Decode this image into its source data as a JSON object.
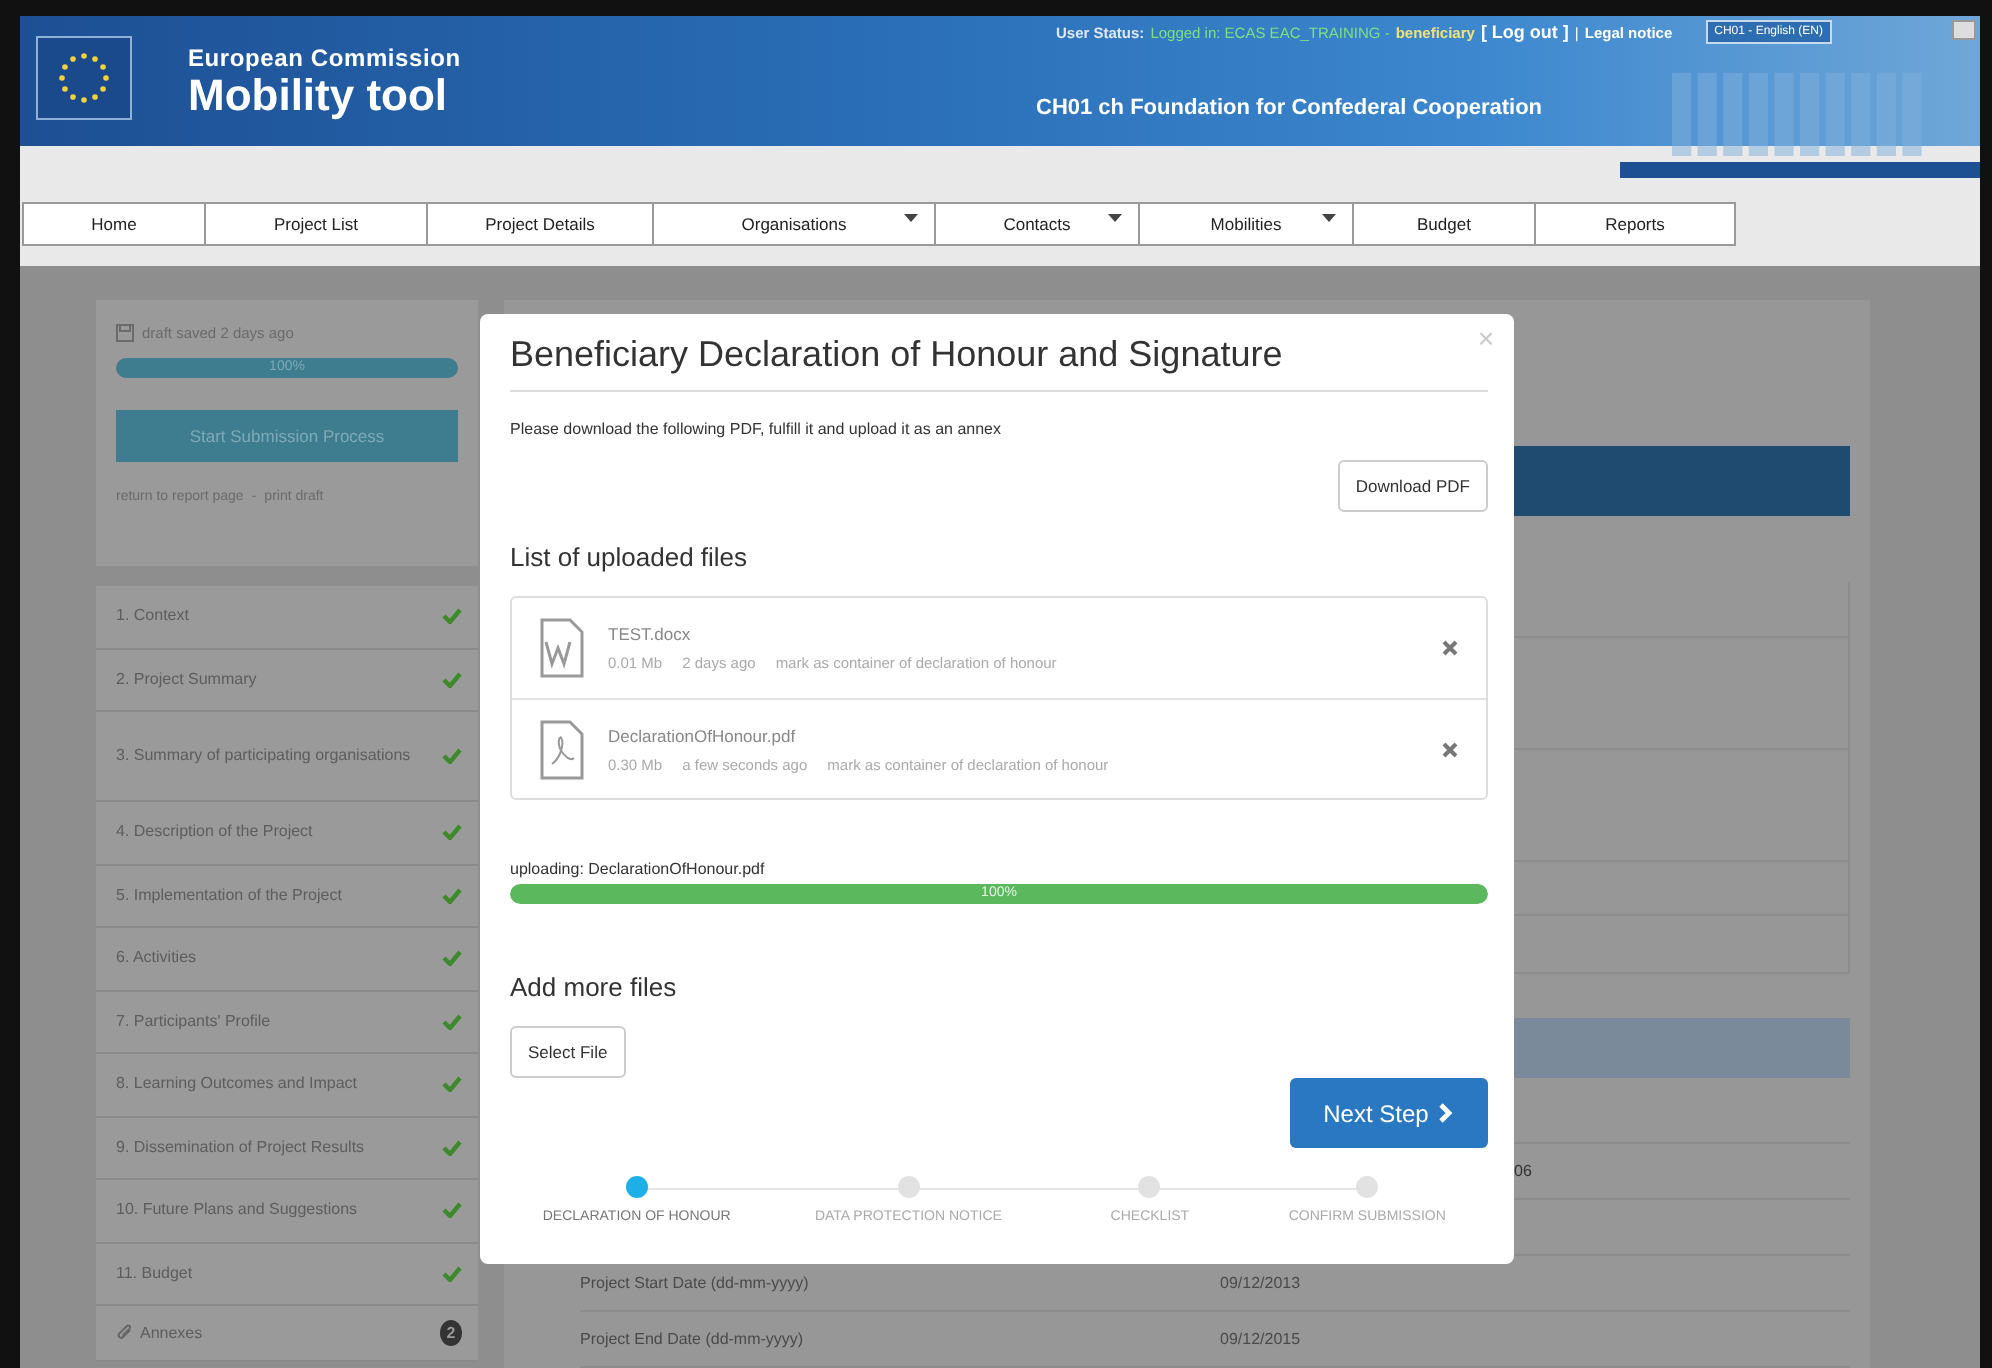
{
  "header": {
    "org": "European Commission",
    "app": "Mobility tool",
    "status_label": "User Status:",
    "status_login": "Logged in: ECAS EAC_TRAINING -",
    "status_role": "beneficiary",
    "logout": "[ Log out ]",
    "separator": "|",
    "legal": "Legal notice",
    "language": "CH01 - English (EN)",
    "organisation": "CH01 ch Foundation for Confederal Cooperation"
  },
  "nav": [
    {
      "label": "Home",
      "dropdown": false
    },
    {
      "label": "Project List",
      "dropdown": false
    },
    {
      "label": "Project Details",
      "dropdown": false
    },
    {
      "label": "Organisations",
      "dropdown": true
    },
    {
      "label": "Contacts",
      "dropdown": true
    },
    {
      "label": "Mobilities",
      "dropdown": true
    },
    {
      "label": "Budget",
      "dropdown": false
    },
    {
      "label": "Reports",
      "dropdown": false
    }
  ],
  "draft_panel": {
    "saved": "draft saved 2 days ago",
    "progress": {
      "level": 1,
      "label": "100%"
    },
    "start_button": "Start Submission Process",
    "return_link": "return to report page",
    "separator": "-",
    "print_link": "print draft"
  },
  "sections": [
    {
      "label": "1. Context",
      "kind": "section",
      "complete": true
    },
    {
      "label": "2. Project Summary",
      "kind": "section",
      "complete": true
    },
    {
      "label": "3. Summary of participating organisations",
      "kind": "section",
      "complete": true
    },
    {
      "label": "4. Description of the Project",
      "kind": "section",
      "complete": true
    },
    {
      "label": "5. Implementation of the Project",
      "kind": "section",
      "complete": true
    },
    {
      "label": "6. Activities",
      "kind": "section",
      "complete": true
    },
    {
      "label": "7. Participants' Profile",
      "kind": "section",
      "complete": true
    },
    {
      "label": "8. Learning Outcomes and Impact",
      "kind": "section",
      "complete": true
    },
    {
      "label": "9. Dissemination of Project Results",
      "kind": "section",
      "complete": true
    },
    {
      "label": "10. Future Plans and Suggestions",
      "kind": "section",
      "complete": true
    },
    {
      "label": "11. Budget",
      "kind": "section",
      "complete": true
    },
    {
      "label": "Annexes",
      "kind": "annexes",
      "count": "2"
    }
  ],
  "details": {
    "partial_value": "06",
    "rows": [
      {
        "label": "Project Start Date (dd-mm-yyyy)",
        "value": "09/12/2013"
      },
      {
        "label": "Project End Date (dd-mm-yyyy)",
        "value": "09/12/2015"
      }
    ]
  },
  "modal": {
    "title": "Beneficiary Declaration of Honour and Signature",
    "close": "×",
    "instruction": "Please download the following PDF, fulfill it and upload it as an annex",
    "download_button": "Download PDF",
    "files_heading": "List of uploaded files",
    "files": [
      {
        "name": "TEST.docx",
        "kind": "word",
        "size": "0.01 Mb",
        "age": "2 days ago",
        "mark_link": "mark as container of declaration of honour"
      },
      {
        "name": "DeclarationOfHonour.pdf",
        "kind": "pdf",
        "size": "0.30 Mb",
        "age": "a few seconds ago",
        "mark_link": "mark as container of declaration of honour"
      }
    ],
    "upload": {
      "label": "uploading: DeclarationOfHonour.pdf",
      "level": 1,
      "percent": "100%"
    },
    "add_heading": "Add more files",
    "select_button": "Select File",
    "next_button": "Next Step",
    "steps": [
      {
        "label": "DECLARATION OF HONOUR",
        "selected": true
      },
      {
        "label": "DATA PROTECTION NOTICE",
        "selected": false
      },
      {
        "label": "CHECKLIST",
        "selected": false
      },
      {
        "label": "CONFIRM SUBMISSION",
        "selected": false
      }
    ]
  }
}
